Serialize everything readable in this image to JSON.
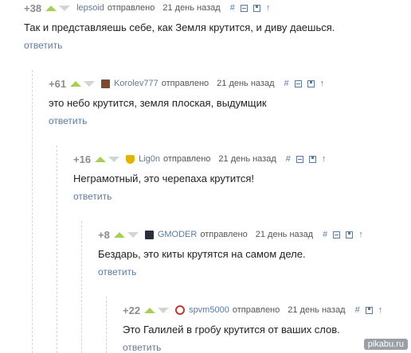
{
  "comments": [
    {
      "score": "+38",
      "author": "lepsoid",
      "sent": "отправлено",
      "date": "21 день назад",
      "text": "Так и представляешь себе, как Земля крутится, и диву даешься.",
      "reply": "ответить",
      "avatar": "none",
      "tools": [
        "#",
        "minus",
        "save",
        "↑"
      ]
    },
    {
      "score": "+61",
      "author": "Korolev777",
      "sent": "отправлено",
      "date": "21 день назад",
      "text": "это небо крутится, земля плоская, выдумщик",
      "reply": "ответить",
      "avatar": "user-avatar-brown",
      "tools": [
        "#",
        "minus",
        "save",
        "↑"
      ]
    },
    {
      "score": "+16",
      "author": "Lig0n",
      "sent": "отправлено",
      "date": "21 день назад",
      "text": "Неграмотный, это черепаха крутится!",
      "reply": "ответить",
      "avatar": "shield-avatar",
      "tools": [
        "#",
        "minus",
        "save",
        "↑"
      ]
    },
    {
      "score": "+8",
      "author": "GMODER",
      "sent": "отправлено",
      "date": "21 день назад",
      "text": "Бездарь, это киты крутятся на самом деле.",
      "reply": "ответить",
      "avatar": "dark-avatar",
      "tools": [
        "#",
        "minus",
        "save",
        "↑"
      ]
    },
    {
      "score": "+22",
      "author": "spvm5000",
      "sent": "отправлено",
      "date": "21 день назад",
      "text": "Это Галилей в гробу крутится от ваших слов.",
      "reply": "ответить",
      "avatar": "target-avatar",
      "tools": [
        "#",
        "save",
        "↑"
      ]
    }
  ],
  "watermark": "pikabu.ru",
  "colors": {
    "accent": "#5c7a9c",
    "upvote": "#a5cf55",
    "score": "#8c8c8c"
  }
}
